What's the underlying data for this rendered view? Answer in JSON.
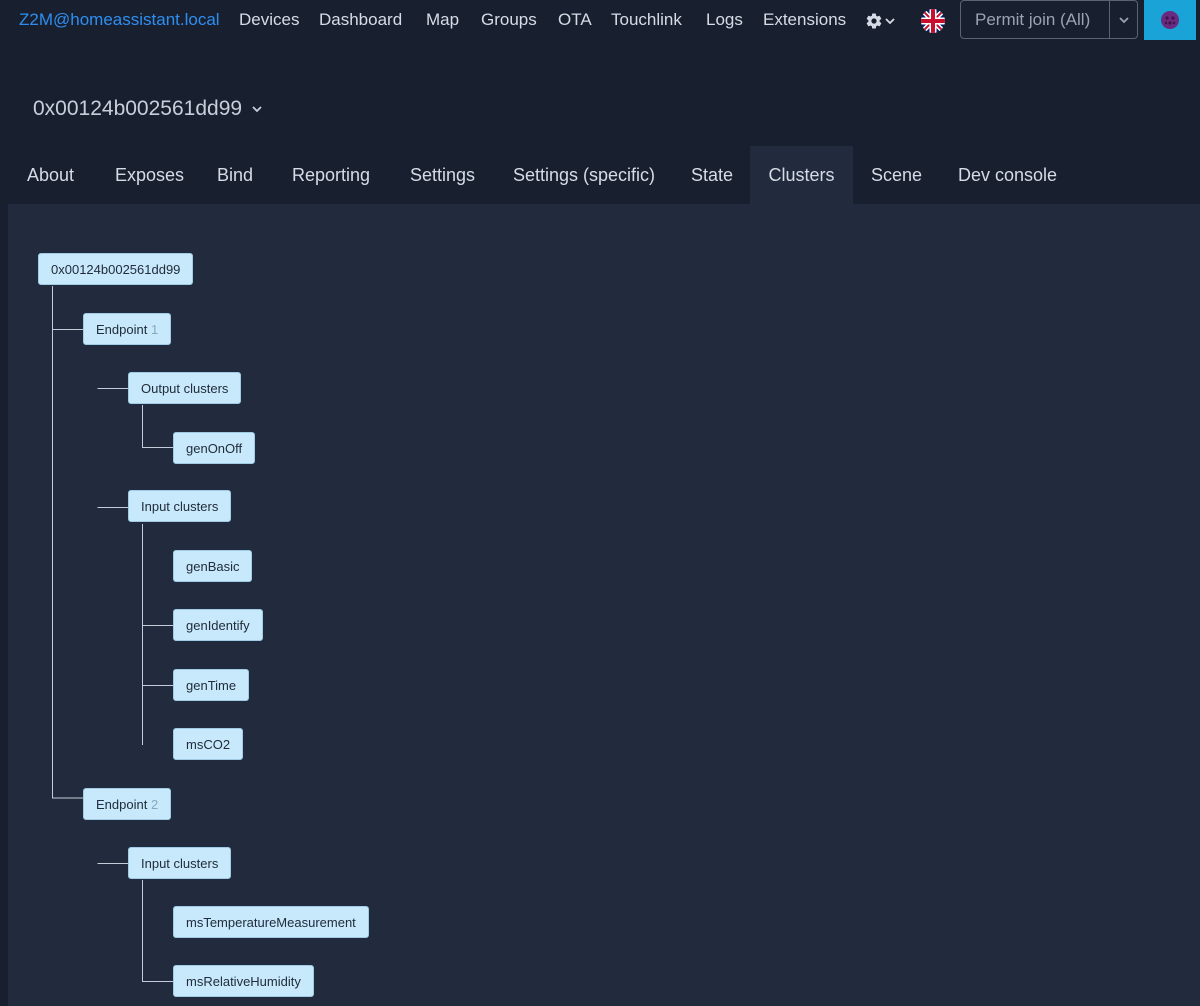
{
  "header": {
    "brand": "Z2M@homeassistant.local",
    "nav": [
      "Devices",
      "Dashboard",
      "Map",
      "Groups",
      "OTA",
      "Touchlink",
      "Logs",
      "Extensions"
    ],
    "permit_join_label": "Permit join (All)",
    "icons": {
      "settings": "gear-icon",
      "language": "uk-flag-icon",
      "avatar": "avatar-icon"
    },
    "colors": {
      "brand": "#2e8ef0",
      "avatar_button": "#1aa3d6"
    }
  },
  "device": {
    "title": "0x00124b002561dd99"
  },
  "tabs": {
    "items": [
      "About",
      "Exposes",
      "Bind",
      "Reporting",
      "Settings",
      "Settings (specific)",
      "State",
      "Clusters",
      "Scene",
      "Dev console"
    ],
    "active": "Clusters"
  },
  "tree": {
    "root": "0x00124b002561dd99",
    "endpoints": [
      {
        "label": "Endpoint",
        "number": "1",
        "groups": [
          {
            "label": "Output clusters",
            "clusters": [
              "genOnOff"
            ]
          },
          {
            "label": "Input clusters",
            "clusters": [
              "genBasic",
              "genIdentify",
              "genTime",
              "msCO2"
            ]
          }
        ]
      },
      {
        "label": "Endpoint",
        "number": "2",
        "groups": [
          {
            "label": "Input clusters",
            "clusters": [
              "msTemperatureMeasurement",
              "msRelativeHumidity"
            ]
          }
        ]
      }
    ]
  }
}
